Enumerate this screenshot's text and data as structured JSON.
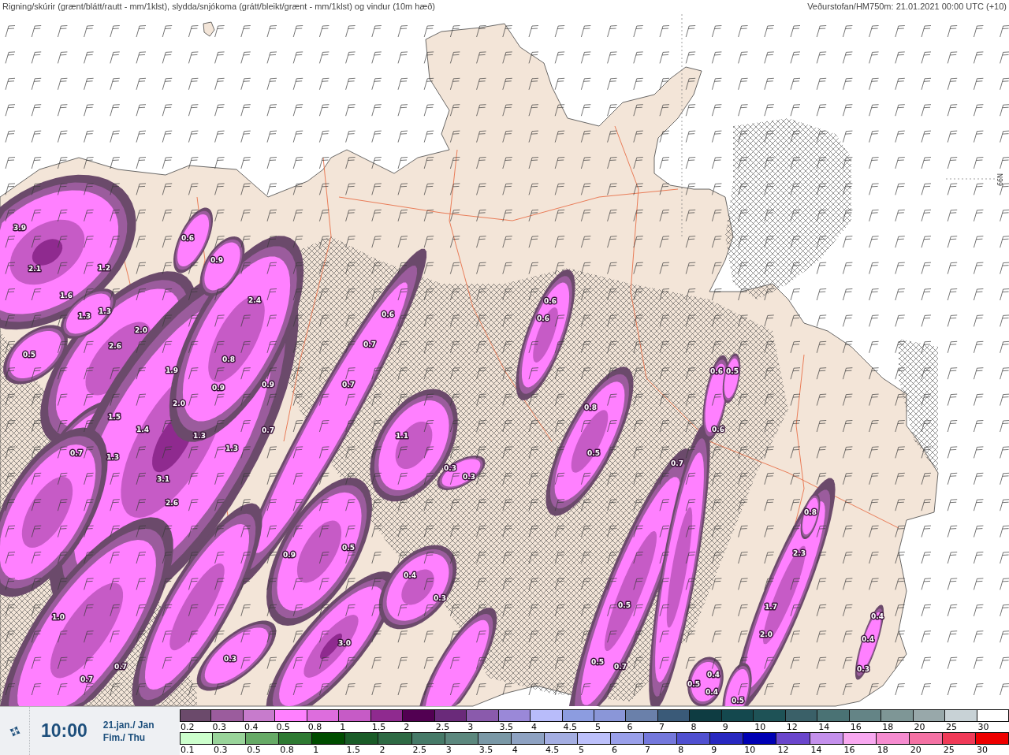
{
  "header": {
    "title": "Rigning/skúrir (grænt/blátt/rautt - mm/1klst), slydda/snjókoma (grátt/bleikt/grænt - mm/1klst) og vindur (10m hæð)",
    "source": "Veðurstofan/HM750m: 21.01.2021 00:00 UTC (+10)"
  },
  "map": {
    "latitude_label": "66N",
    "value_labels": [
      "3.9",
      "2.1",
      "1.2",
      "1.6",
      "1.3",
      "1.3",
      "0.5",
      "2.6",
      "2.0",
      "1.9",
      "2.0",
      "1.5",
      "1.4",
      "0.7",
      "1.3",
      "1.3",
      "1.3",
      "3.1",
      "2.6",
      "0.6",
      "0.9",
      "2.4",
      "0.8",
      "0.9",
      "0.9",
      "0.7",
      "0.6",
      "0.7",
      "0.7",
      "1.1",
      "0.3",
      "0.3",
      "0.6",
      "0.6",
      "0.8",
      "0.5",
      "0.6",
      "0.5",
      "0.6",
      "0.7",
      "0.5",
      "0.9",
      "0.4",
      "0.3",
      "3.0",
      "1.0",
      "0.3",
      "0.7",
      "0.7",
      "0.5",
      "0.5",
      "0.7",
      "2.3",
      "1.7",
      "2.0",
      "0.5",
      "0.8",
      "0.4",
      "0.4",
      "0.3",
      "0.5",
      "0.4",
      "0.4"
    ]
  },
  "time_panel": {
    "time": "10:00",
    "date": "21.jan./ Jan",
    "weekday": "Fim./ Thu"
  },
  "legend": {
    "upper_row": [
      {
        "label": "0.2",
        "color": "#6b4a6b"
      },
      {
        "label": "0.3",
        "color": "#9b5c9d"
      },
      {
        "label": "0.4",
        "color": "#c77bcc"
      },
      {
        "label": "0.5",
        "color": "#ff80ff"
      },
      {
        "label": "0.8",
        "color": "#dd6ddd"
      },
      {
        "label": "1",
        "color": "#c65bc6"
      },
      {
        "label": "1.5",
        "color": "#8f2a8f"
      },
      {
        "label": "2",
        "color": "#520052"
      },
      {
        "label": "2.5",
        "color": "#6a2a7a"
      },
      {
        "label": "3",
        "color": "#8a5aac"
      },
      {
        "label": "3.5",
        "color": "#9a88d8"
      },
      {
        "label": "4",
        "color": "#b8bcfa"
      },
      {
        "label": "4.5",
        "color": "#8c9ce0"
      },
      {
        "label": "5",
        "color": "#8a96d8"
      },
      {
        "label": "6",
        "color": "#6a80aa"
      },
      {
        "label": "7",
        "color": "#3a5a78"
      },
      {
        "label": "8",
        "color": "#0e3c42"
      },
      {
        "label": "9",
        "color": "#14484e"
      },
      {
        "label": "10",
        "color": "#1e5256"
      },
      {
        "label": "12",
        "color": "#3a6068"
      },
      {
        "label": "14",
        "color": "#4a7274"
      },
      {
        "label": "16",
        "color": "#648486"
      },
      {
        "label": "18",
        "color": "#7e9696"
      },
      {
        "label": "20",
        "color": "#98a8aa"
      },
      {
        "label": "25",
        "color": "#c8d2d6"
      },
      {
        "label": "30",
        "color": "#ffffff"
      }
    ],
    "lower_row": [
      {
        "label": "0.1",
        "color": "#ccffcc"
      },
      {
        "label": "0.3",
        "color": "#99d49a"
      },
      {
        "label": "0.5",
        "color": "#66aa66"
      },
      {
        "label": "0.8",
        "color": "#2e7a32"
      },
      {
        "label": "1",
        "color": "#004d00"
      },
      {
        "label": "1.5",
        "color": "#1a5c28"
      },
      {
        "label": "2",
        "color": "#2e6a44"
      },
      {
        "label": "2.5",
        "color": "#467a68"
      },
      {
        "label": "3",
        "color": "#5c887e"
      },
      {
        "label": "3.5",
        "color": "#7a98a6"
      },
      {
        "label": "4",
        "color": "#8ea2c2"
      },
      {
        "label": "4.5",
        "color": "#a4aee2"
      },
      {
        "label": "5",
        "color": "#bcc0fa"
      },
      {
        "label": "6",
        "color": "#9aa0ea"
      },
      {
        "label": "7",
        "color": "#7478dc"
      },
      {
        "label": "8",
        "color": "#5050d0"
      },
      {
        "label": "9",
        "color": "#2828c0"
      },
      {
        "label": "10",
        "color": "#0000b4"
      },
      {
        "label": "12",
        "color": "#6a46cc"
      },
      {
        "label": "14",
        "color": "#c490ec"
      },
      {
        "label": "16",
        "color": "#f8a8f0"
      },
      {
        "label": "18",
        "color": "#f68cd0"
      },
      {
        "label": "20",
        "color": "#f472a4"
      },
      {
        "label": "25",
        "color": "#f03a58"
      },
      {
        "label": "30",
        "color": "#ee0000"
      }
    ]
  }
}
